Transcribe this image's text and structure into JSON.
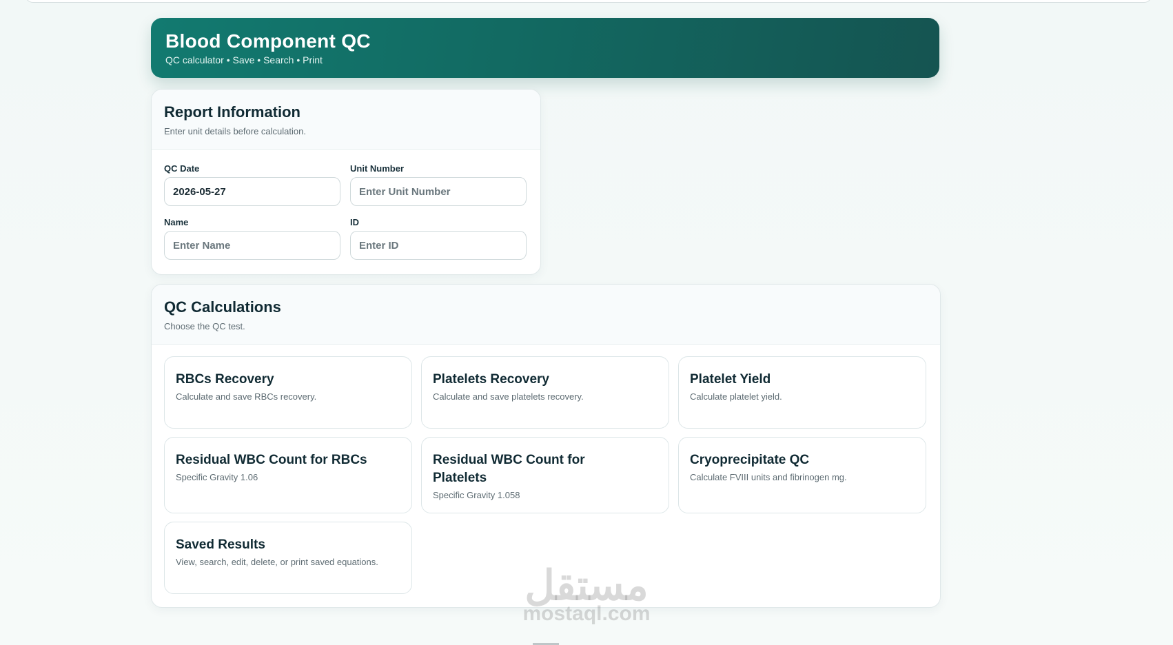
{
  "header": {
    "title": "Blood Component QC",
    "subtitle": "QC calculator • Save • Search • Print"
  },
  "report": {
    "title": "Report Information",
    "hint": "Enter unit details before calculation.",
    "qc_date_label": "QC Date",
    "qc_date_value": "2026-05-27",
    "unit_label": "Unit Number",
    "unit_placeholder": "Enter Unit Number",
    "name_label": "Name",
    "name_placeholder": "Enter Name",
    "id_label": "ID",
    "id_placeholder": "Enter ID"
  },
  "calc": {
    "title": "QC Calculations",
    "hint": "Choose the QC test.",
    "tiles": [
      {
        "title": "RBCs Recovery",
        "desc": "Calculate and save RBCs recovery."
      },
      {
        "title": "Platelets Recovery",
        "desc": "Calculate and save platelets recovery."
      },
      {
        "title": "Platelet Yield",
        "desc": "Calculate platelet yield."
      },
      {
        "title": "Residual WBC Count for RBCs",
        "desc": "Specific Gravity 1.06"
      },
      {
        "title": "Residual WBC Count for Platelets",
        "desc": "Specific Gravity 1.058"
      },
      {
        "title": "Cryoprecipitate QC",
        "desc": "Calculate FVIII units and fibrinogen mg."
      },
      {
        "title": "Saved Results",
        "desc": "View, search, edit, delete, or print saved equations."
      }
    ]
  },
  "watermark": {
    "arabic": "مستقل",
    "latin": "mostaql.com"
  }
}
